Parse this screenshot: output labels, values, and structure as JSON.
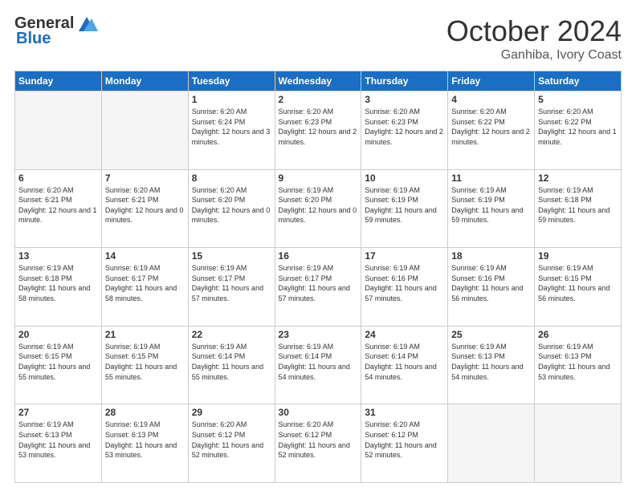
{
  "header": {
    "logo_general": "General",
    "logo_blue": "Blue",
    "month_year": "October 2024",
    "location": "Ganhiba, Ivory Coast"
  },
  "weekdays": [
    "Sunday",
    "Monday",
    "Tuesday",
    "Wednesday",
    "Thursday",
    "Friday",
    "Saturday"
  ],
  "weeks": [
    [
      {
        "num": "",
        "detail": ""
      },
      {
        "num": "",
        "detail": ""
      },
      {
        "num": "1",
        "detail": "Sunrise: 6:20 AM\nSunset: 6:24 PM\nDaylight: 12 hours and 3 minutes."
      },
      {
        "num": "2",
        "detail": "Sunrise: 6:20 AM\nSunset: 6:23 PM\nDaylight: 12 hours and 2 minutes."
      },
      {
        "num": "3",
        "detail": "Sunrise: 6:20 AM\nSunset: 6:23 PM\nDaylight: 12 hours and 2 minutes."
      },
      {
        "num": "4",
        "detail": "Sunrise: 6:20 AM\nSunset: 6:22 PM\nDaylight: 12 hours and 2 minutes."
      },
      {
        "num": "5",
        "detail": "Sunrise: 6:20 AM\nSunset: 6:22 PM\nDaylight: 12 hours and 1 minute."
      }
    ],
    [
      {
        "num": "6",
        "detail": "Sunrise: 6:20 AM\nSunset: 6:21 PM\nDaylight: 12 hours and 1 minute."
      },
      {
        "num": "7",
        "detail": "Sunrise: 6:20 AM\nSunset: 6:21 PM\nDaylight: 12 hours and 0 minutes."
      },
      {
        "num": "8",
        "detail": "Sunrise: 6:20 AM\nSunset: 6:20 PM\nDaylight: 12 hours and 0 minutes."
      },
      {
        "num": "9",
        "detail": "Sunrise: 6:19 AM\nSunset: 6:20 PM\nDaylight: 12 hours and 0 minutes."
      },
      {
        "num": "10",
        "detail": "Sunrise: 6:19 AM\nSunset: 6:19 PM\nDaylight: 11 hours and 59 minutes."
      },
      {
        "num": "11",
        "detail": "Sunrise: 6:19 AM\nSunset: 6:19 PM\nDaylight: 11 hours and 59 minutes."
      },
      {
        "num": "12",
        "detail": "Sunrise: 6:19 AM\nSunset: 6:18 PM\nDaylight: 11 hours and 59 minutes."
      }
    ],
    [
      {
        "num": "13",
        "detail": "Sunrise: 6:19 AM\nSunset: 6:18 PM\nDaylight: 11 hours and 58 minutes."
      },
      {
        "num": "14",
        "detail": "Sunrise: 6:19 AM\nSunset: 6:17 PM\nDaylight: 11 hours and 58 minutes."
      },
      {
        "num": "15",
        "detail": "Sunrise: 6:19 AM\nSunset: 6:17 PM\nDaylight: 11 hours and 57 minutes."
      },
      {
        "num": "16",
        "detail": "Sunrise: 6:19 AM\nSunset: 6:17 PM\nDaylight: 11 hours and 57 minutes."
      },
      {
        "num": "17",
        "detail": "Sunrise: 6:19 AM\nSunset: 6:16 PM\nDaylight: 11 hours and 57 minutes."
      },
      {
        "num": "18",
        "detail": "Sunrise: 6:19 AM\nSunset: 6:16 PM\nDaylight: 11 hours and 56 minutes."
      },
      {
        "num": "19",
        "detail": "Sunrise: 6:19 AM\nSunset: 6:15 PM\nDaylight: 11 hours and 56 minutes."
      }
    ],
    [
      {
        "num": "20",
        "detail": "Sunrise: 6:19 AM\nSunset: 6:15 PM\nDaylight: 11 hours and 55 minutes."
      },
      {
        "num": "21",
        "detail": "Sunrise: 6:19 AM\nSunset: 6:15 PM\nDaylight: 11 hours and 55 minutes."
      },
      {
        "num": "22",
        "detail": "Sunrise: 6:19 AM\nSunset: 6:14 PM\nDaylight: 11 hours and 55 minutes."
      },
      {
        "num": "23",
        "detail": "Sunrise: 6:19 AM\nSunset: 6:14 PM\nDaylight: 11 hours and 54 minutes."
      },
      {
        "num": "24",
        "detail": "Sunrise: 6:19 AM\nSunset: 6:14 PM\nDaylight: 11 hours and 54 minutes."
      },
      {
        "num": "25",
        "detail": "Sunrise: 6:19 AM\nSunset: 6:13 PM\nDaylight: 11 hours and 54 minutes."
      },
      {
        "num": "26",
        "detail": "Sunrise: 6:19 AM\nSunset: 6:13 PM\nDaylight: 11 hours and 53 minutes."
      }
    ],
    [
      {
        "num": "27",
        "detail": "Sunrise: 6:19 AM\nSunset: 6:13 PM\nDaylight: 11 hours and 53 minutes."
      },
      {
        "num": "28",
        "detail": "Sunrise: 6:19 AM\nSunset: 6:13 PM\nDaylight: 11 hours and 53 minutes."
      },
      {
        "num": "29",
        "detail": "Sunrise: 6:20 AM\nSunset: 6:12 PM\nDaylight: 11 hours and 52 minutes."
      },
      {
        "num": "30",
        "detail": "Sunrise: 6:20 AM\nSunset: 6:12 PM\nDaylight: 11 hours and 52 minutes."
      },
      {
        "num": "31",
        "detail": "Sunrise: 6:20 AM\nSunset: 6:12 PM\nDaylight: 11 hours and 52 minutes."
      },
      {
        "num": "",
        "detail": ""
      },
      {
        "num": "",
        "detail": ""
      }
    ]
  ]
}
